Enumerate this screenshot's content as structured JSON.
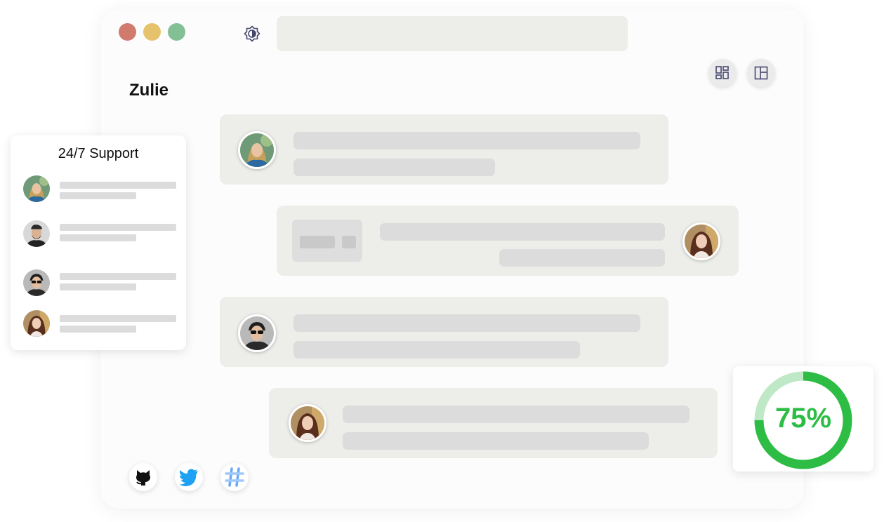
{
  "chat": {
    "title": "Zulie"
  },
  "support": {
    "title": "24/7 Support",
    "contacts": [
      {
        "avatar": "woman-blonde-avatar"
      },
      {
        "avatar": "man-beard-avatar"
      },
      {
        "avatar": "man-sunglasses-avatar"
      },
      {
        "avatar": "woman-brunette-avatar"
      }
    ]
  },
  "messages": [
    {
      "side": "left",
      "avatar": "woman-blonde-avatar"
    },
    {
      "side": "right",
      "avatar": "woman-brunette-avatar",
      "has_attachment": true
    },
    {
      "side": "left",
      "avatar": "man-sunglasses-avatar"
    },
    {
      "side": "left",
      "avatar": "woman-brunette-avatar"
    }
  ],
  "progress": {
    "value": 75,
    "label": "75%",
    "color": "#2dbd44",
    "track_color": "#bfe8c6"
  },
  "socials": [
    "github-icon",
    "twitter-icon",
    "slack-icon"
  ],
  "colors": {
    "close": "#d17b6e",
    "minimize": "#e6c26c",
    "maximize": "#84c095",
    "icon": "#45466e",
    "twitter": "#1da1f2"
  }
}
